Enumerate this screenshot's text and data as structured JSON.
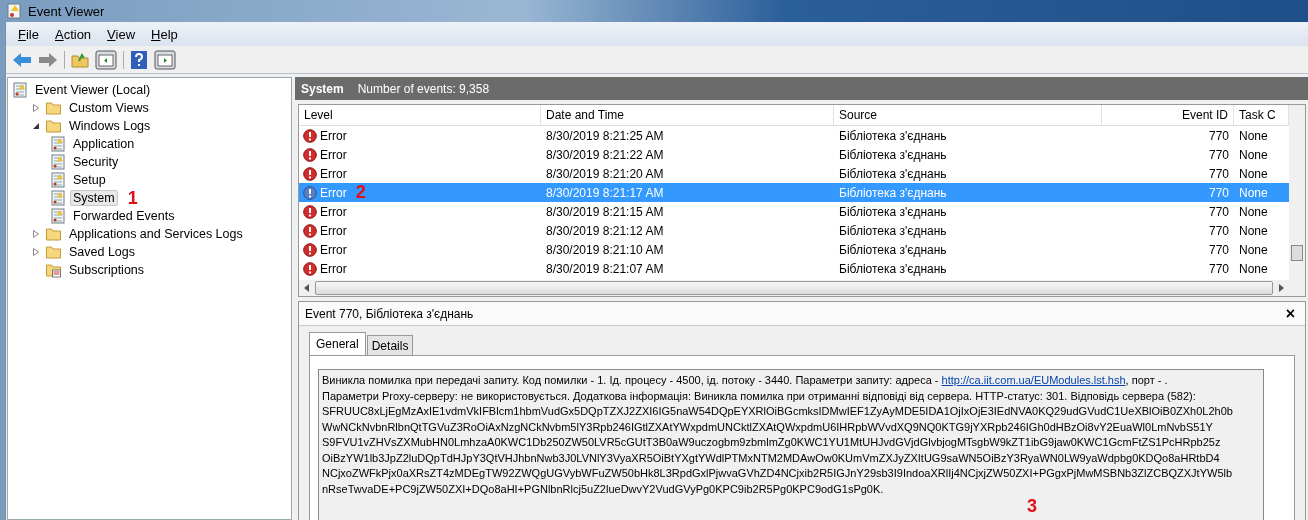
{
  "window": {
    "title": "Event Viewer"
  },
  "menu": [
    {
      "label": "File"
    },
    {
      "label": "Action"
    },
    {
      "label": "View"
    },
    {
      "label": "Help"
    }
  ],
  "tree": [
    {
      "label": "Event Viewer (Local)",
      "kind": "root",
      "selected": false,
      "children": [
        {
          "label": "Custom Views",
          "kind": "folder",
          "expanded": false,
          "selected": false
        },
        {
          "label": "Windows Logs",
          "kind": "folder",
          "expanded": true,
          "selected": false,
          "children": [
            {
              "label": "Application",
              "kind": "log",
              "selected": false
            },
            {
              "label": "Security",
              "kind": "log",
              "selected": false
            },
            {
              "label": "Setup",
              "kind": "log",
              "selected": false
            },
            {
              "label": "System",
              "kind": "log",
              "selected": true,
              "marker": "1"
            },
            {
              "label": "Forwarded Events",
              "kind": "log",
              "selected": false
            }
          ]
        },
        {
          "label": "Applications and Services Logs",
          "kind": "folder",
          "expanded": false,
          "selected": false
        },
        {
          "label": "Saved Logs",
          "kind": "folder",
          "expanded": false,
          "selected": false
        },
        {
          "label": "Subscriptions",
          "kind": "leaf",
          "selected": false
        }
      ]
    }
  ],
  "log_header": {
    "title": "System",
    "count": "Number of events: 9,358"
  },
  "table": {
    "columns": [
      "Level",
      "Date and Time",
      "Source",
      "Event ID",
      "Task C"
    ],
    "rows": [
      {
        "level": "Error",
        "date": "8/30/2019 8:21:25 AM",
        "source": "Бібліотека з'єднань",
        "event_id": "770",
        "task": "None",
        "selected": false
      },
      {
        "level": "Error",
        "date": "8/30/2019 8:21:22 AM",
        "source": "Бібліотека з'єднань",
        "event_id": "770",
        "task": "None",
        "selected": false
      },
      {
        "level": "Error",
        "date": "8/30/2019 8:21:20 AM",
        "source": "Бібліотека з'єднань",
        "event_id": "770",
        "task": "None",
        "selected": false
      },
      {
        "level": "Error",
        "date": "8/30/2019 8:21:17 AM",
        "source": "Бібліотека з'єднань",
        "event_id": "770",
        "task": "None",
        "selected": true,
        "marker": "2"
      },
      {
        "level": "Error",
        "date": "8/30/2019 8:21:15 AM",
        "source": "Бібліотека з'єднань",
        "event_id": "770",
        "task": "None",
        "selected": false
      },
      {
        "level": "Error",
        "date": "8/30/2019 8:21:12 AM",
        "source": "Бібліотека з'єднань",
        "event_id": "770",
        "task": "None",
        "selected": false
      },
      {
        "level": "Error",
        "date": "8/30/2019 8:21:10 AM",
        "source": "Бібліотека з'єднань",
        "event_id": "770",
        "task": "None",
        "selected": false
      },
      {
        "level": "Error",
        "date": "8/30/2019 8:21:07 AM",
        "source": "Бібліотека з'єднань",
        "event_id": "770",
        "task": "None",
        "selected": false
      }
    ]
  },
  "detail": {
    "title": "Event 770, Бібліотека з'єднань",
    "close": "×",
    "tabs": [
      {
        "label": "General",
        "selected": true
      },
      {
        "label": "Details",
        "selected": false
      }
    ],
    "message": {
      "before": "Виникла помилка при передачі запиту. Код помилки - 1. Ід. процесу - 4500, ід. потоку - 3440. Параметри запиту: адреса - ",
      "link": "http://ca.iit.com.ua/EUModules.lst.hsh",
      "after": ", порт - .\nПараметри Proxy-серверу: не використовується. Додаткова інформація: Виникла помилка при отриманні відповіді від сервера. HTTP-статус: 301. Відповідь сервера (582):\nSFRUUC8xLjEgMzAxIE1vdmVkIFBlcm1hbmVudGx5DQpTZXJ2ZXI6IG5naW54DQpEYXRlOiBGcmksIDMwIEF1ZyAyMDE5IDA1OjIxOjE3IEdNVA0KQ29udGVudC1UeXBlOiB0ZXh0L2h0b\nWwNCkNvbnRlbnQtTGVuZ3RoOiAxNzgNCkNvbm5lY3Rpb246IGtlZXAtYWxpdmUNCktlZXAtQWxpdmU6IHRpbWVvdXQ9NQ0KTG9jYXRpb246IGh0dHBzOi8vY2EuaWl0LmNvbS51Y\nS9FVU1vZHVsZXMubHN0LmhzaA0KWC1Db250ZW50LVR5cGUtT3B0aW9uczogbm9zbmlmZg0KWC1YU1MtUHJvdGVjdGlvbjogMTsgbW9kZT1ibG9jaw0KWC1GcmFtZS1PcHRpb25z\nOiBzYW1lb3JpZ2luDQpTdHJpY3QtVHJhbnNwb3J0LVNlY3VyaXR5OiBtYXgtYWdlPTMxNTM2MDAwOw0KUmVmZXJyZXItUG9saWN5OiBzY3RyaWN0LW9yaWdpbg0KDQo8aHRtbD4\nNCjxoZWFkPjx0aXRsZT4zMDEgTW92ZWQgUGVybWFuZW50bHk8L3RpdGxlPjwvaGVhZD4NCjxib2R5IGJnY29sb3I9IndoaXRlIj4NCjxjZW50ZXI+PGgxPjMwMSBNb3ZlZCBQZXJtYW5lb\nnRseTwvaDE+PC9jZW50ZXI+DQo8aHI+PGNlbnRlcj5uZ2lueDwvY2VudGVyPg0KPC9ib2R5Pg0KPC9odG1sPg0K.",
      "marker": "3"
    }
  }
}
